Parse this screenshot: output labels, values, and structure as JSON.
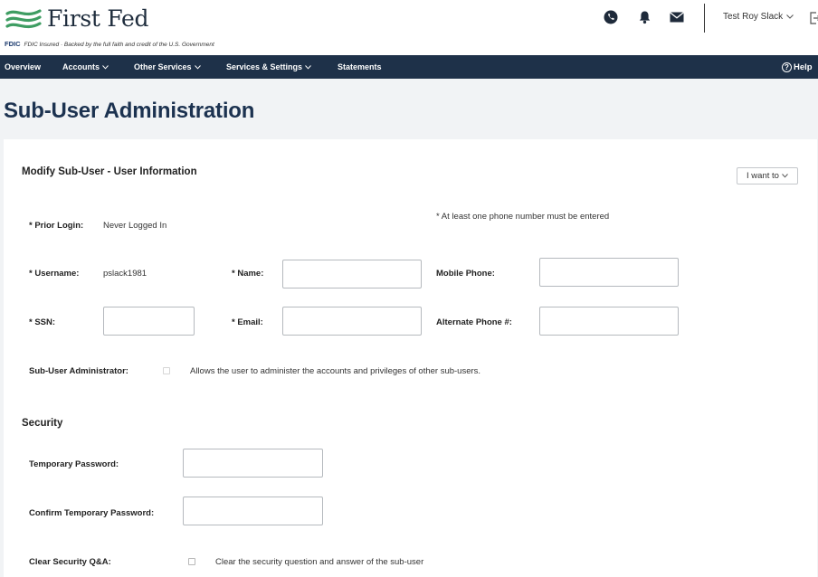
{
  "brand": {
    "name": "First Fed",
    "fdic_mark": "FDIC",
    "fdic_text": "FDIC Insured · Backed by the full faith and credit of the U.S. Government"
  },
  "header": {
    "user_name": "Test Roy Slack",
    "icons": [
      "phone-icon",
      "bell-icon",
      "mail-icon",
      "logout-icon"
    ]
  },
  "nav": {
    "items": [
      {
        "label": "Overview",
        "dropdown": false
      },
      {
        "label": "Accounts",
        "dropdown": true
      },
      {
        "label": "Other Services",
        "dropdown": true
      },
      {
        "label": "Services & Settings",
        "dropdown": true
      },
      {
        "label": "Statements",
        "dropdown": false
      }
    ],
    "help_label": "Help"
  },
  "page": {
    "title": "Sub-User Administration"
  },
  "user_info": {
    "section_title": "Modify Sub-User - User Information",
    "i_want_to": "I want to",
    "phone_note": "* At least one phone number must be entered",
    "prior_login_label": "* Prior Login:",
    "prior_login_value": "Never Logged In",
    "username_label": "* Username:",
    "username_value": "pslack1981",
    "name_label": "* Name:",
    "name_value": "",
    "mobile_label": "Mobile Phone:",
    "mobile_value": "",
    "ssn_label": "* SSN:",
    "ssn_value": "",
    "email_label": "* Email:",
    "email_value": "",
    "alt_phone_label": "Alternate Phone #:",
    "alt_phone_value": "",
    "admin_label": "Sub-User Administrator:",
    "admin_checked": false,
    "admin_desc": "Allows the user to administer the accounts and privileges of other sub-users."
  },
  "security": {
    "section_title": "Security",
    "temp_password_label": "Temporary Password:",
    "temp_password_value": "",
    "confirm_password_label": "Confirm Temporary Password:",
    "confirm_password_value": "",
    "clear_qa_label": "Clear Security Q&A:",
    "clear_qa_checked": false,
    "clear_qa_desc": "Clear the security question and answer of the sub-user"
  },
  "colors": {
    "nav_bg": "#1e3149",
    "title": "#1c3250",
    "logo_green": "#3e9d62",
    "page_bg": "#f1f3f5"
  }
}
